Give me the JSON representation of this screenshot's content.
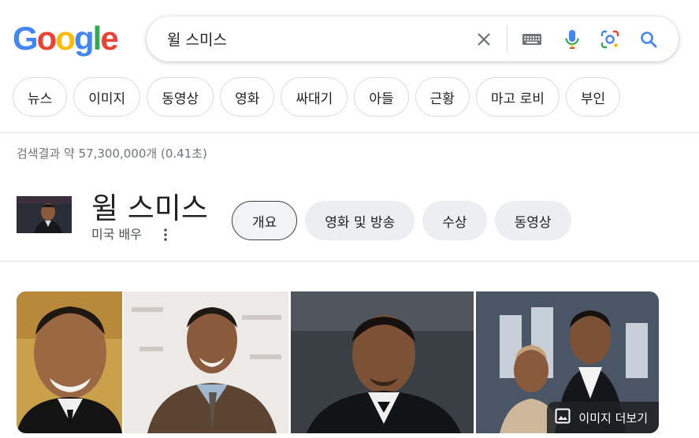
{
  "logo": {
    "letters": [
      "G",
      "o",
      "o",
      "g",
      "l",
      "e"
    ],
    "colors": [
      "#4285F4",
      "#EA4335",
      "#FBBC05",
      "#4285F4",
      "#34A853",
      "#EA4335"
    ]
  },
  "search": {
    "query": "윌 스미스"
  },
  "icons": {
    "clear": "close-icon",
    "keyboard": "keyboard-icon",
    "voice": "microphone-icon",
    "lens": "camera-lens-icon",
    "search": "search-icon"
  },
  "chips": [
    "뉴스",
    "이미지",
    "동영상",
    "영화",
    "싸대기",
    "아들",
    "근황",
    "마고 로비",
    "부인"
  ],
  "results": {
    "stats": "검색결과 약 57,300,000개 (0.41초)"
  },
  "knowledge_panel": {
    "title": "윌 스미스",
    "subtitle": "미국 배우",
    "tabs": [
      "개요",
      "영화 및 방송",
      "수상",
      "동영상"
    ],
    "active_tab": "개요"
  },
  "gallery": {
    "more_label": "이미지 더보기"
  },
  "colors": {
    "accent_blue": "#1a73e8",
    "gray_text": "#70757a"
  }
}
